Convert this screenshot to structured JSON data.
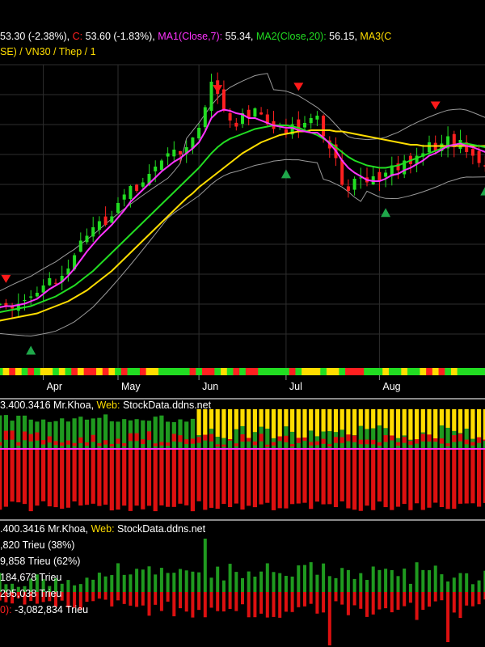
{
  "colors": {
    "white": "#ffffff",
    "red": "#ff2020",
    "magenta": "#ff33ff",
    "green": "#22dd22",
    "yellow": "#ffdd00",
    "grid": "#2e2e2e",
    "bb": "#9a9a9a",
    "volred": "#dd1010",
    "volgreen": "#1f9a1f",
    "volyellow": "#ffdd00",
    "dark": "#000000"
  },
  "header": {
    "close_change": "53.30 (-2.38%), ",
    "c_label": "C: ",
    "c_value": "53.60 (-1.83%), ",
    "ma1": "MA1(Close,7): ",
    "ma1_value": "55.34, ",
    "ma2": "MA2(Close,20): ",
    "ma2_value": "56.15, ",
    "ma3": "MA3(C",
    "line2": "SE) / VN30 / Thep / 1"
  },
  "months": [
    "Apr",
    "May",
    "Jun",
    "Jul",
    "Aug"
  ],
  "panel2": {
    "id": "3.400.3416 Mr.Khoa, ",
    "web_label": "Web: ",
    "web_value": "StockData.ddns.net"
  },
  "panel3": {
    "id": ".400.3416 Mr.Khoa, ",
    "web_label": "Web: ",
    "web_value": "StockData.ddns.net",
    "lines": [
      ",820 Trieu (38%)",
      "9,858 Trieu (62%)",
      "184,678 Trieu",
      "295,038 Trieu"
    ],
    "last_prefix": "0): ",
    "last_value": "-3,082,834 Trieu"
  },
  "chart_data": {
    "type": "candlestick",
    "price_ylim": [
      38,
      62
    ],
    "series": [
      {
        "name": "MA1(Close,7)",
        "color": "magenta"
      },
      {
        "name": "MA2(Close,20)",
        "color": "green"
      },
      {
        "name": "MA3(C",
        "color": "yellow"
      }
    ],
    "close": [
      42.0,
      42.3,
      42.1,
      41.9,
      42.3,
      42.6,
      42.9,
      43.2,
      43.8,
      44.4,
      44.0,
      44.6,
      45.2,
      46.3,
      47.5,
      47.9,
      48.6,
      49.1,
      48.8,
      49.5,
      50.6,
      51.3,
      52.0,
      51.6,
      52.3,
      53.0,
      53.6,
      54.1,
      54.7,
      55.0,
      54.6,
      55.2,
      56.0,
      56.8,
      58.5,
      60.6,
      59.6,
      58.2,
      57.4,
      56.9,
      58.0,
      57.6,
      58.4,
      57.9,
      57.1,
      56.7,
      57.0,
      56.3,
      57.1,
      56.5,
      57.2,
      57.6,
      57.8,
      56.1,
      55.1,
      54.3,
      52.1,
      51.6,
      52.6,
      52.7,
      52.3,
      52.8,
      52.4,
      53.1,
      53.7,
      53.3,
      54.1,
      53.8,
      54.5,
      54.7,
      55.6,
      54.9,
      55.5,
      56.1,
      55.2,
      55.8,
      54.8,
      54.5,
      53.9,
      53.6
    ],
    "ma1": [
      41.8,
      42.0,
      42.1,
      42.1,
      42.2,
      42.3,
      42.5,
      42.7,
      43.1,
      43.5,
      43.8,
      44.1,
      44.6,
      45.2,
      45.9,
      46.6,
      47.2,
      47.8,
      48.3,
      48.8,
      49.4,
      50.0,
      50.7,
      51.2,
      51.7,
      52.2,
      52.7,
      53.2,
      53.6,
      54.0,
      54.3,
      54.7,
      55.1,
      55.6,
      56.5,
      57.6,
      58.1,
      58.3,
      58.2,
      58.0,
      57.9,
      57.6,
      57.6,
      57.4,
      57.2,
      57.0,
      56.9,
      56.8,
      56.8,
      56.6,
      56.5,
      56.4,
      56.4,
      56.0,
      55.5,
      54.9,
      54.1,
      53.5,
      53.1,
      52.8,
      52.5,
      52.4,
      52.4,
      52.6,
      52.9,
      53.0,
      53.3,
      53.5,
      53.8,
      54.1,
      54.5,
      54.7,
      55.0,
      55.3,
      55.4,
      55.5,
      55.3,
      55.2,
      55.0,
      54.8
    ],
    "ma2": [
      41.5,
      41.6,
      41.7,
      41.8,
      41.9,
      42.0,
      42.1,
      42.3,
      42.5,
      42.7,
      42.9,
      43.2,
      43.5,
      43.8,
      44.2,
      44.6,
      45.0,
      45.5,
      46.0,
      46.5,
      47.0,
      47.5,
      48.0,
      48.5,
      49.0,
      49.5,
      50.0,
      50.5,
      51.0,
      51.5,
      52.0,
      52.5,
      53.0,
      53.5,
      54.1,
      54.7,
      55.2,
      55.6,
      55.9,
      56.1,
      56.3,
      56.5,
      56.7,
      56.8,
      56.9,
      57.0,
      57.0,
      57.0,
      56.9,
      56.8,
      56.6,
      56.4,
      56.2,
      55.9,
      55.6,
      55.2,
      54.8,
      54.4,
      54.1,
      53.9,
      53.7,
      53.6,
      53.5,
      53.5,
      53.6,
      53.7,
      53.9,
      54.1,
      54.3,
      54.5,
      54.7,
      54.9,
      55.1,
      55.3,
      55.4,
      55.5,
      55.5,
      55.4,
      55.3,
      55.2
    ],
    "ma3": [
      40.8,
      40.9,
      41.0,
      41.1,
      41.2,
      41.3,
      41.4,
      41.5,
      41.7,
      41.9,
      42.1,
      42.3,
      42.5,
      42.8,
      43.1,
      43.4,
      43.8,
      44.2,
      44.6,
      45.0,
      45.5,
      46.0,
      46.5,
      47.0,
      47.5,
      48.0,
      48.5,
      49.0,
      49.5,
      50.0,
      50.5,
      51.0,
      51.4,
      51.9,
      52.3,
      52.7,
      53.1,
      53.5,
      53.9,
      54.3,
      54.7,
      55.0,
      55.3,
      55.6,
      55.8,
      56.0,
      56.2,
      56.3,
      56.4,
      56.5,
      56.5,
      56.6,
      56.6,
      56.6,
      56.6,
      56.5,
      56.5,
      56.4,
      56.3,
      56.2,
      56.1,
      56.0,
      55.9,
      55.8,
      55.7,
      55.6,
      55.5,
      55.4,
      55.4,
      55.3,
      55.3,
      55.3,
      55.3,
      55.3,
      55.3,
      55.3,
      55.3,
      55.3,
      55.3,
      55.3
    ],
    "buy_signals": [
      6,
      47,
      63,
      79
    ],
    "sell_signals": [
      2,
      36,
      49,
      71
    ],
    "month_bar_index": [
      8,
      20,
      33,
      47,
      62
    ]
  }
}
